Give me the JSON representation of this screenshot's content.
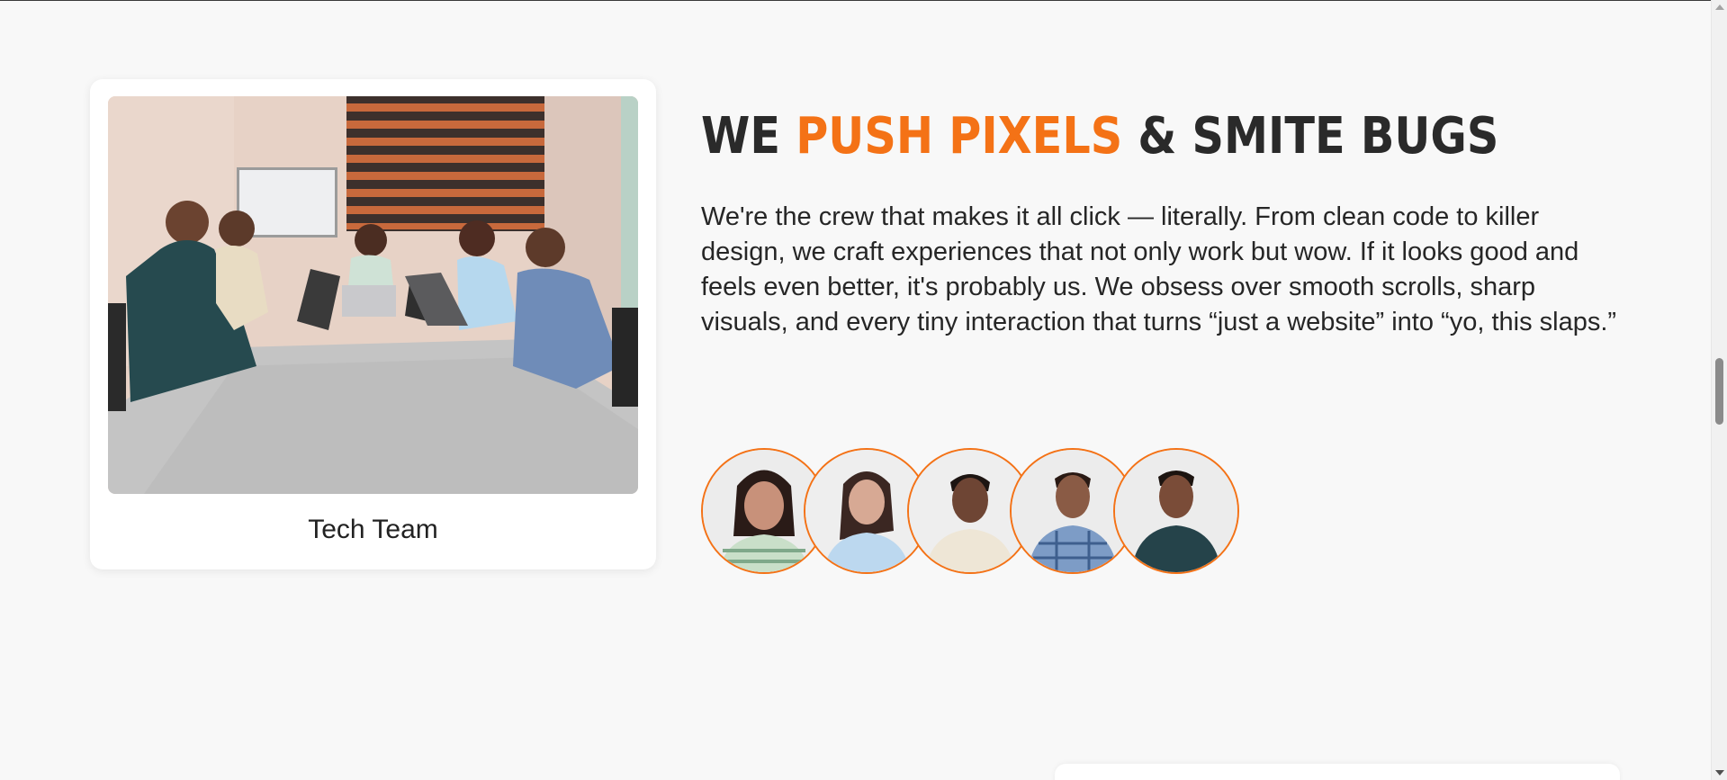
{
  "team_card": {
    "caption": "Tech Team"
  },
  "headline": {
    "part1": "WE ",
    "accent": "PUSH PIXELS",
    "part2": " & SMITE BUGS"
  },
  "about": {
    "text": "We're the crew that makes it all click — literally. From clean code to killer design, we craft experiences that not only work but wow. If it looks good and feels even better, it's probably us. We obsess over smooth scrolls, sharp visuals, and every tiny interaction that turns “just a website” into “yo, this slaps.”"
  },
  "colors": {
    "accent": "#f47216",
    "text": "#262626",
    "background": "#f8f8f8"
  },
  "team_members": [
    {
      "icon": "team-member-photo-1"
    },
    {
      "icon": "team-member-photo-2"
    },
    {
      "icon": "team-member-photo-3"
    },
    {
      "icon": "team-member-photo-4"
    },
    {
      "icon": "team-member-photo-5"
    }
  ]
}
